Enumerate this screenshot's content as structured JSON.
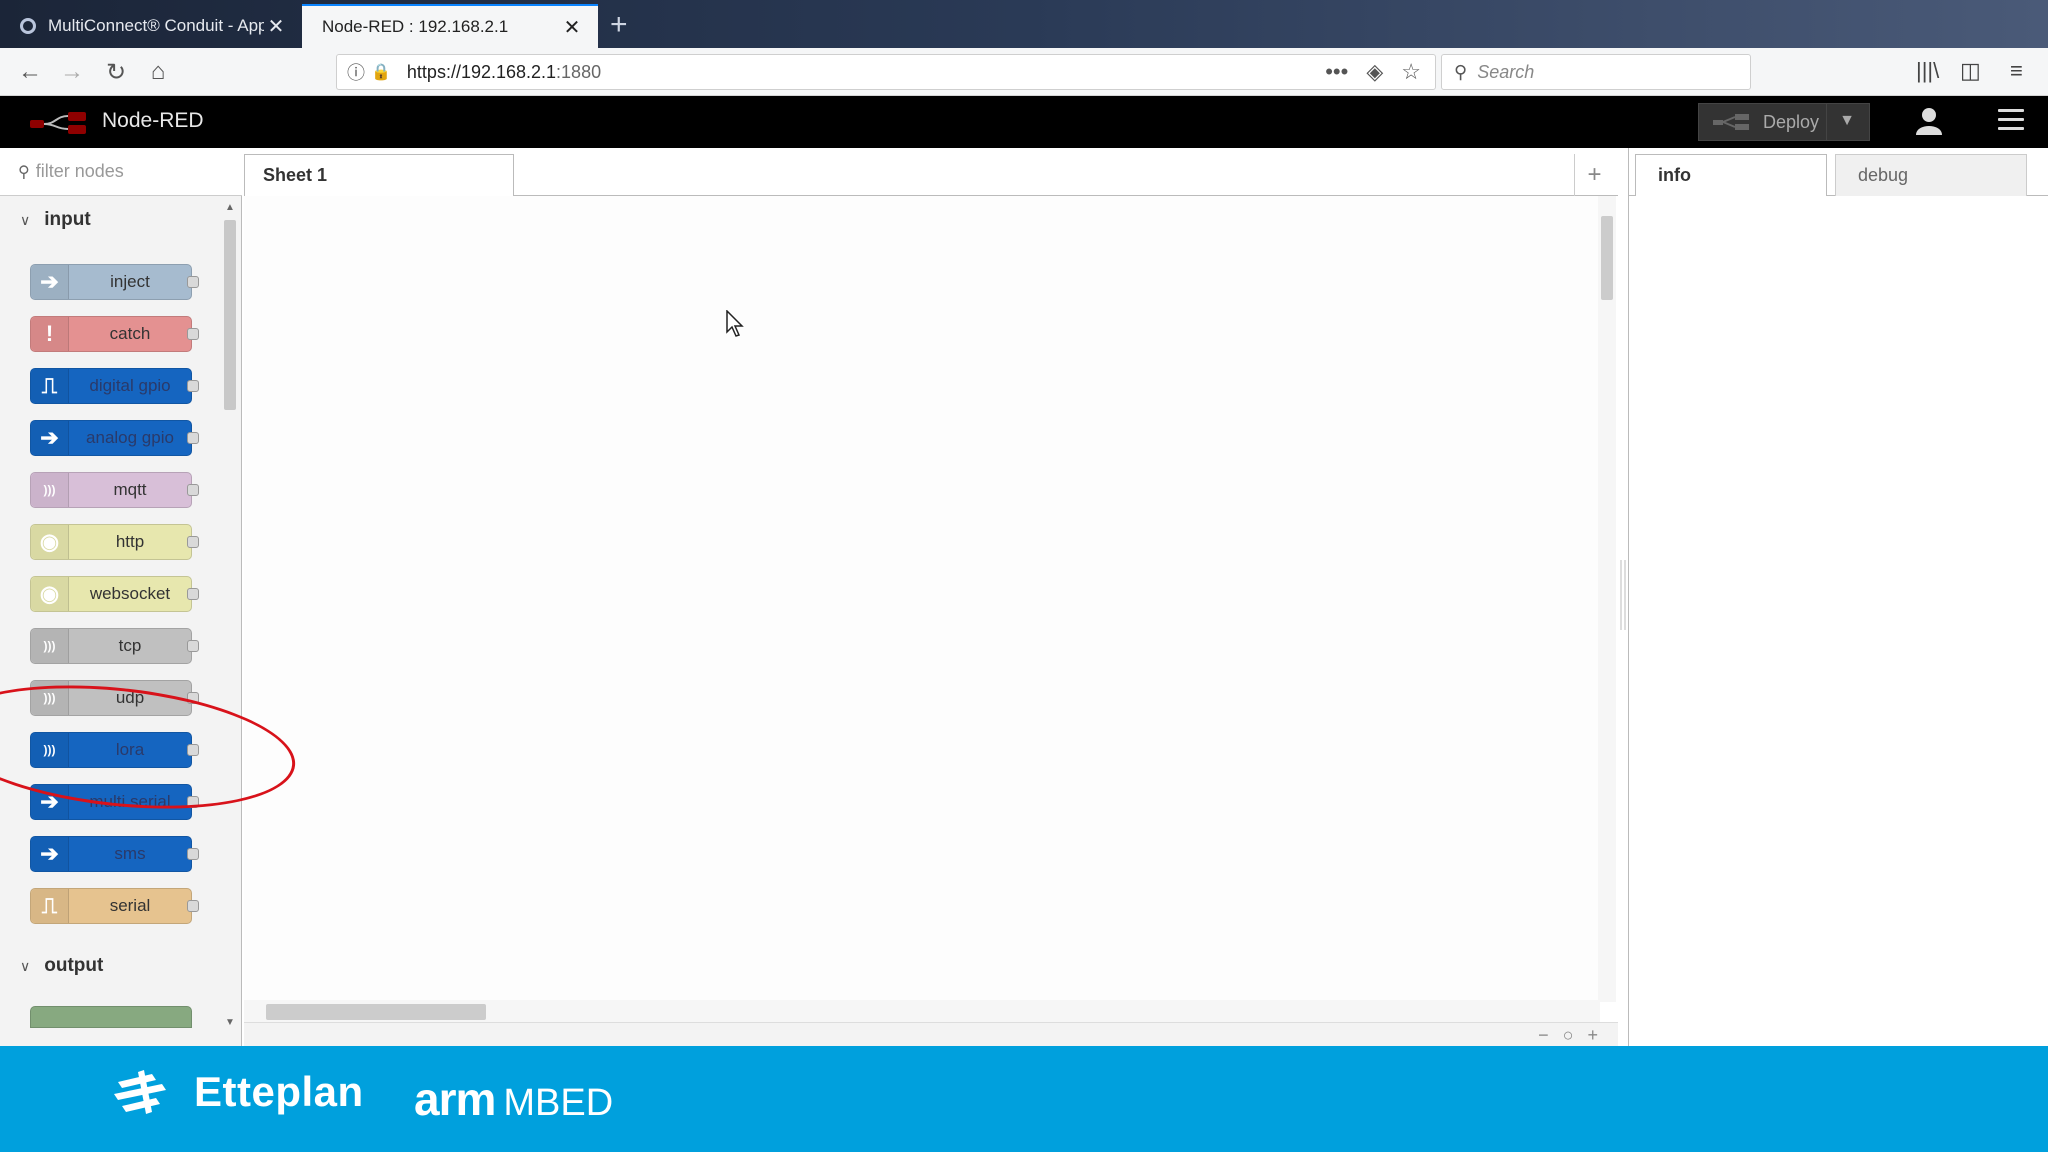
{
  "browser": {
    "tabs": [
      {
        "label": "MultiConnect® Conduit - Appl",
        "active": false
      },
      {
        "label": "Node-RED : 192.168.2.1",
        "active": true
      }
    ],
    "new_tab_icon": "plus-icon",
    "url": {
      "host": "https://192.168.2.1",
      "port": ":1880"
    },
    "search_placeholder": "Search"
  },
  "header": {
    "title": "Node-RED",
    "deploy_label": "Deploy"
  },
  "palette": {
    "filter_placeholder": "filter nodes",
    "categories": [
      {
        "label": "input",
        "expanded": true
      },
      {
        "label": "output",
        "expanded": true
      }
    ],
    "nodes": [
      {
        "label": "inject",
        "color": "#a6bbcf",
        "icon": "arrow-right-icon"
      },
      {
        "label": "catch",
        "color": "#e49191",
        "icon": "exclamation-icon"
      },
      {
        "label": "digital gpio",
        "color": "#1565c0",
        "icon": "square-wave-icon"
      },
      {
        "label": "analog gpio",
        "color": "#1565c0",
        "icon": "arrow-right-icon"
      },
      {
        "label": "mqtt",
        "color": "#d8bfd8",
        "icon": "radio-wave-icon"
      },
      {
        "label": "http",
        "color": "#e7e7ae",
        "icon": "globe-icon"
      },
      {
        "label": "websocket",
        "color": "#e7e7ae",
        "icon": "globe-icon"
      },
      {
        "label": "tcp",
        "color": "#c0c0c0",
        "icon": "radio-wave-icon"
      },
      {
        "label": "udp",
        "color": "#c0c0c0",
        "icon": "radio-wave-icon"
      },
      {
        "label": "lora",
        "color": "#1565c0",
        "icon": "radio-wave-icon"
      },
      {
        "label": "multi serial",
        "color": "#1565c0",
        "icon": "arrow-right-icon"
      },
      {
        "label": "sms",
        "color": "#1565c0",
        "icon": "arrow-right-icon"
      },
      {
        "label": "serial",
        "color": "#e6c38f",
        "icon": "square-wave-icon"
      }
    ]
  },
  "workspace": {
    "tab_label": "Sheet 1",
    "add_tab_icon": "plus-icon"
  },
  "sidebar": {
    "tabs": [
      {
        "label": "info",
        "active": true
      },
      {
        "label": "debug",
        "active": false
      }
    ]
  },
  "banner": {
    "company": "Etteplan",
    "partner_arm": "arm",
    "partner_mbed": "MBED",
    "color": "#00a0dd"
  },
  "annotation": {
    "color": "#d8121a",
    "highlights": "lora"
  }
}
